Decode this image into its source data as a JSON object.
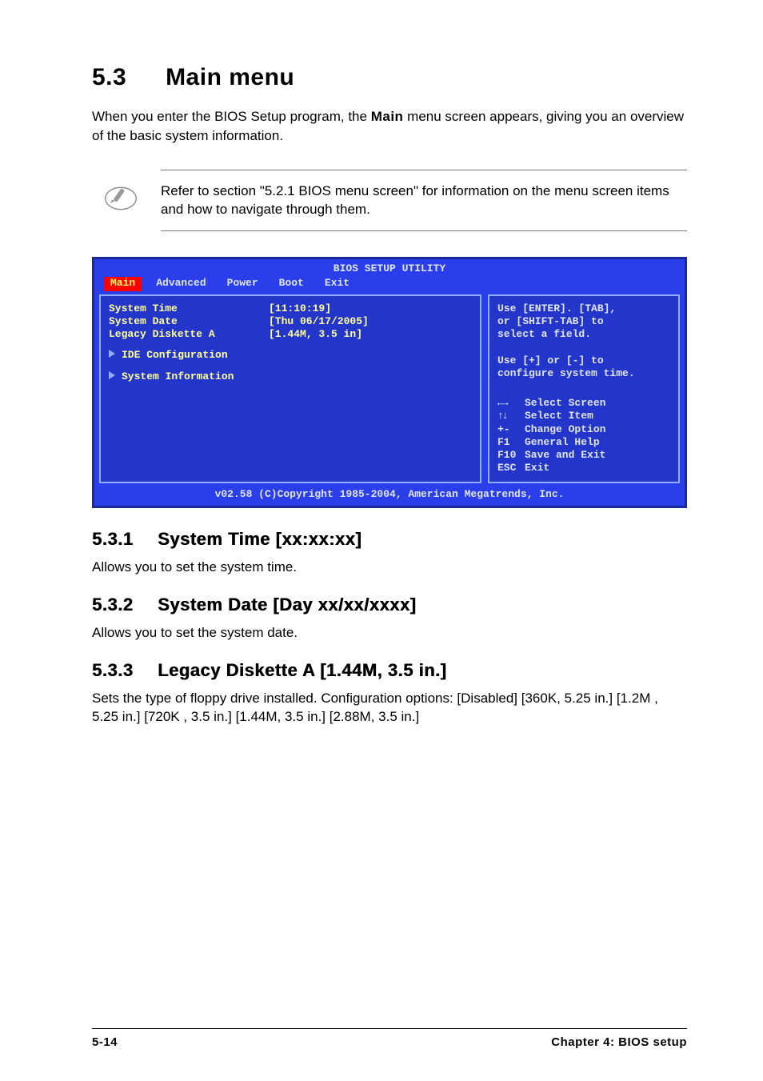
{
  "section": {
    "num": "5.3",
    "title": "Main menu"
  },
  "intro_pre": "When you enter the BIOS Setup program, the ",
  "intro_bold": "Main",
  "intro_post": " menu screen appears, giving you an overview of the basic system information.",
  "note": "Refer to section \"5.2.1  BIOS menu screen\" for information on the menu screen items and how to navigate through them.",
  "icons": {
    "pencil": "pencil-note-icon"
  },
  "bios": {
    "title": "BIOS SETUP UTILITY",
    "tabs": [
      "Main",
      "Advanced",
      "Power",
      "Boot",
      "Exit"
    ],
    "active_tab": "Main",
    "items": [
      {
        "label": "System Time",
        "value": "[11:10:19]"
      },
      {
        "label": "System Date",
        "value": "[Thu 06/17/2005]"
      },
      {
        "label": "Legacy Diskette A",
        "value": "[1.44M, 3.5 in]"
      }
    ],
    "submenus": [
      "IDE Configuration",
      "System Information"
    ],
    "help_top": [
      "Use [ENTER]. [TAB],",
      "or [SHIFT-TAB] to",
      "select a field.",
      "",
      "Use [+] or [-] to",
      "configure system time."
    ],
    "nav": [
      {
        "key": "↔",
        "label": "Select Screen"
      },
      {
        "key": "↕",
        "label": "Select Item"
      },
      {
        "key": "+-",
        "label": "Change Option"
      },
      {
        "key": "F1",
        "label": "General Help"
      },
      {
        "key": "F10",
        "label": "Save and Exit"
      },
      {
        "key": "ESC",
        "label": "Exit"
      }
    ],
    "copyright": "v02.58 (C)Copyright 1985-2004, American Megatrends, Inc."
  },
  "subs": {
    "s1": {
      "num": "5.3.1",
      "title": "System Time [xx:xx:xx]",
      "body": "Allows you to set the system time."
    },
    "s2": {
      "num": "5.3.2",
      "title": "System Date [Day xx/xx/xxxx]",
      "body": "Allows you to set the system date."
    },
    "s3": {
      "num": "5.3.3",
      "title": "Legacy Diskette A [1.44M, 3.5 in.]",
      "body": "Sets the type of floppy drive installed. Configuration options: [Disabled] [360K, 5.25 in.] [1.2M , 5.25 in.] [720K , 3.5 in.] [1.44M, 3.5 in.] [2.88M, 3.5 in.]"
    }
  },
  "footer": {
    "left": "5-14",
    "right": "Chapter 4: BIOS setup"
  }
}
